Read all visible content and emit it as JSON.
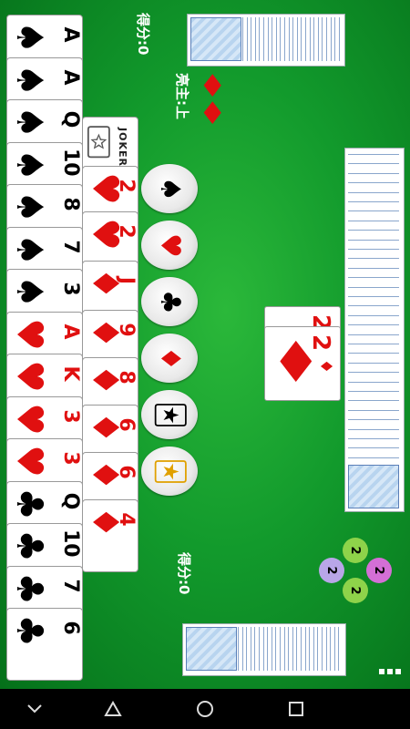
{
  "top_player": {
    "score_label": "得分:0"
  },
  "bottom_player": {
    "score_label": "得分:0"
  },
  "trump": {
    "label": "亮主:上",
    "suit_symbol": "♦",
    "color": "#e01010"
  },
  "suit_buttons": [
    {
      "symbol": "♠",
      "color": "#000000",
      "name": "spade"
    },
    {
      "symbol": "♥",
      "color": "#e01010",
      "name": "heart"
    },
    {
      "symbol": "♣",
      "color": "#000000",
      "name": "club"
    },
    {
      "symbol": "♦",
      "color": "#e01010",
      "name": "diamond"
    },
    {
      "symbol": "🃏",
      "color": "#000000",
      "name": "black-joker"
    },
    {
      "symbol": "🃏",
      "color": "#e0a000",
      "name": "red-joker"
    }
  ],
  "hand_left": [
    {
      "rank": "A",
      "suit": "♠",
      "color": "#000000"
    },
    {
      "rank": "A",
      "suit": "♠",
      "color": "#000000"
    },
    {
      "rank": "Q",
      "suit": "♠",
      "color": "#000000"
    },
    {
      "rank": "10",
      "suit": "♠",
      "color": "#000000"
    },
    {
      "rank": "8",
      "suit": "♠",
      "color": "#000000"
    },
    {
      "rank": "7",
      "suit": "♠",
      "color": "#000000"
    },
    {
      "rank": "3",
      "suit": "♠",
      "color": "#000000"
    },
    {
      "rank": "A",
      "suit": "♥",
      "color": "#e01010"
    },
    {
      "rank": "K",
      "suit": "♥",
      "color": "#e01010"
    },
    {
      "rank": "3",
      "suit": "♥",
      "color": "#e01010"
    },
    {
      "rank": "3",
      "suit": "♥",
      "color": "#e01010"
    },
    {
      "rank": "Q",
      "suit": "♣",
      "color": "#000000"
    },
    {
      "rank": "10",
      "suit": "♣",
      "color": "#000000"
    },
    {
      "rank": "7",
      "suit": "♣",
      "color": "#000000"
    },
    {
      "rank": "6",
      "suit": "♣",
      "color": "#000000"
    }
  ],
  "hand_right": [
    {
      "rank": "JOKER",
      "suit": "",
      "color": "#000000"
    },
    {
      "rank": "2",
      "suit": "♥",
      "color": "#e01010"
    },
    {
      "rank": "2",
      "suit": "♥",
      "color": "#e01010"
    },
    {
      "rank": "J",
      "suit": "♦",
      "color": "#e01010"
    },
    {
      "rank": "9",
      "suit": "♦",
      "color": "#e01010"
    },
    {
      "rank": "8",
      "suit": "♦",
      "color": "#e01010"
    },
    {
      "rank": "6",
      "suit": "♦",
      "color": "#e01010"
    },
    {
      "rank": "6",
      "suit": "♦",
      "color": "#e01010"
    },
    {
      "rank": "4",
      "suit": "♦",
      "color": "#e01010"
    }
  ],
  "played_cards": [
    {
      "rank": "2",
      "suit": "♦",
      "color": "#e01010"
    },
    {
      "rank": "2",
      "suit": "♦",
      "color": "#e01010"
    }
  ],
  "level_badges": [
    "2",
    "2",
    "2",
    "2"
  ],
  "menu_icon": "more-dots-icon",
  "nav": {
    "back": "back-icon",
    "home": "home-icon",
    "recents": "recents-icon"
  }
}
